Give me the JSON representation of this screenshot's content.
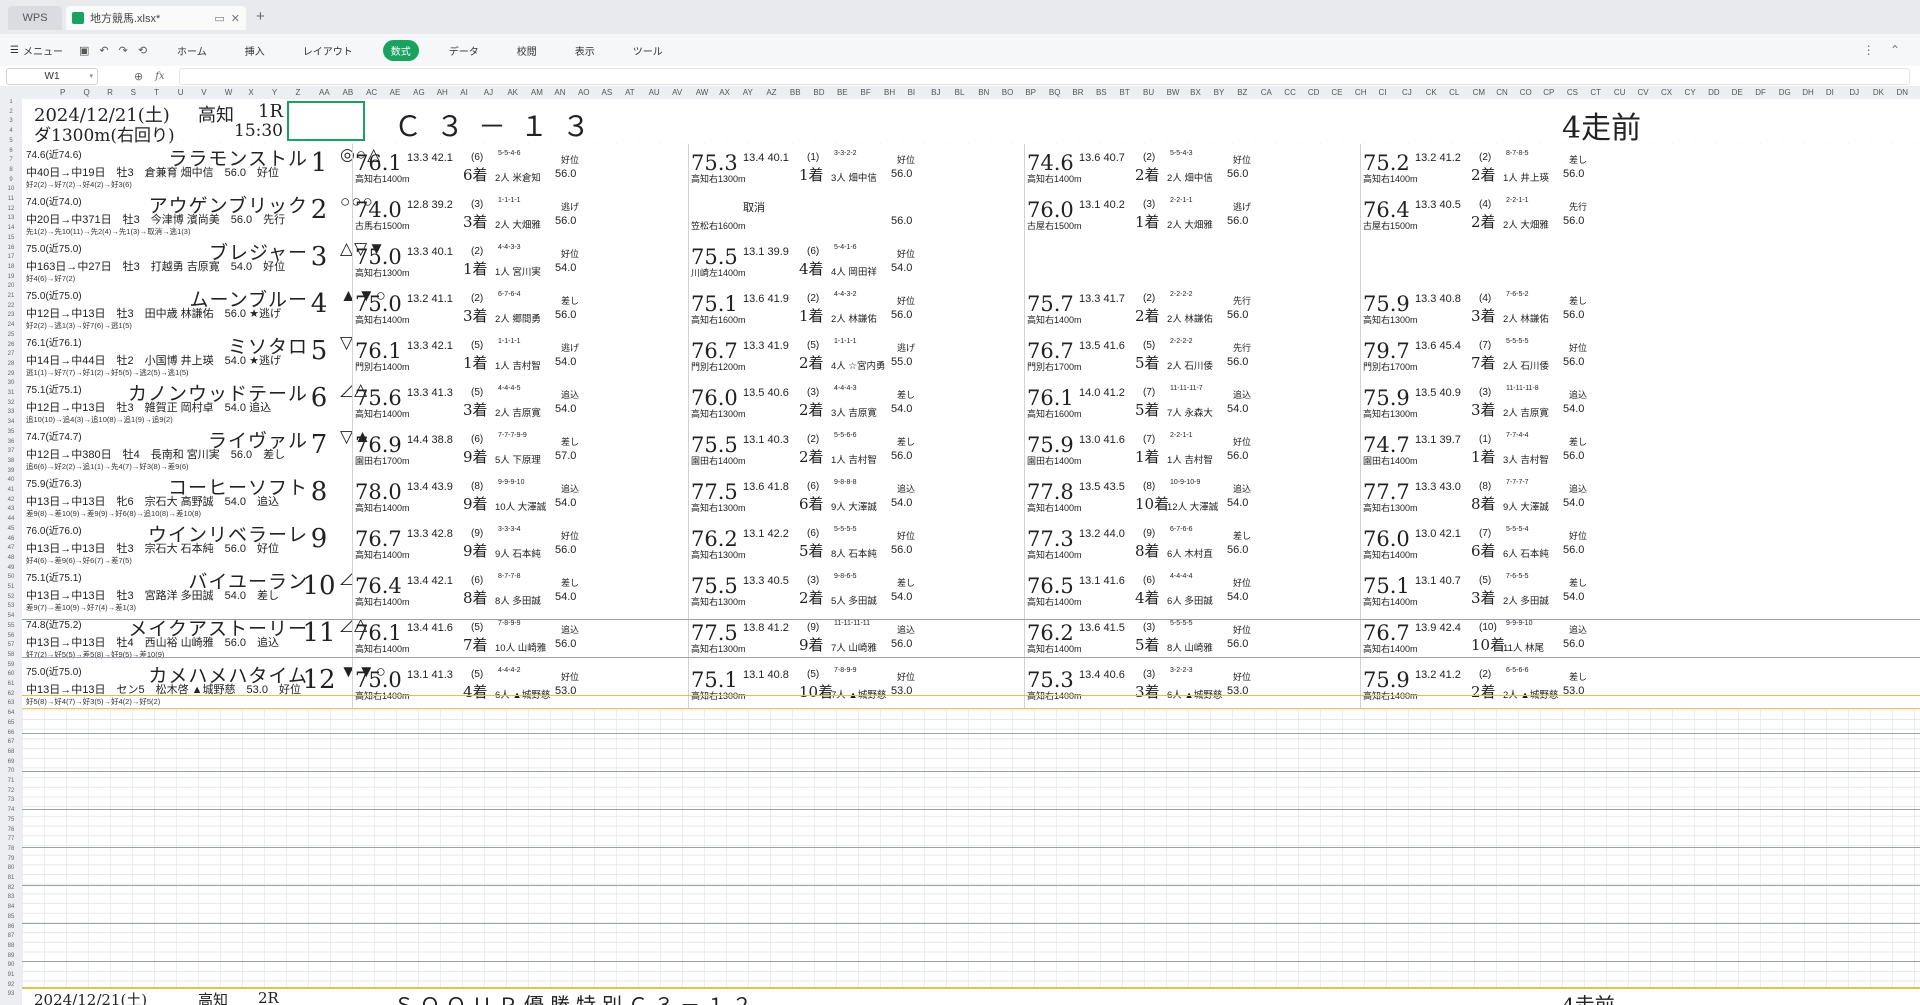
{
  "window": {
    "wps_tab": "WPS",
    "file_tab": "地方競馬.xlsx*"
  },
  "ribbon": {
    "menu": "メニュー",
    "tabs": [
      "ホーム",
      "挿入",
      "レイアウト",
      "数式",
      "データ",
      "校閲",
      "表示",
      "ツール"
    ],
    "active_tab": "数式"
  },
  "formula_bar": {
    "name_box": "W1",
    "fx": "fx"
  },
  "columns": [
    "P",
    "Q",
    "R",
    "S",
    "T",
    "U",
    "V",
    "W",
    "X",
    "Y",
    "Z",
    "AA",
    "AB",
    "AC",
    "AE",
    "AG",
    "AH",
    "AI",
    "AJ",
    "AK",
    "AM",
    "AN",
    "AO",
    "AS",
    "AT",
    "AU",
    "AV",
    "AW",
    "AX",
    "AY",
    "AZ",
    "BB",
    "BD",
    "BE",
    "BF",
    "BH",
    "BI",
    "BJ",
    "BL",
    "BN",
    "BO",
    "BP",
    "BQ",
    "BR",
    "BS",
    "BT",
    "BU",
    "BW",
    "BX",
    "BY",
    "BZ",
    "CA",
    "CC",
    "CD",
    "CE",
    "CH",
    "CI",
    "CJ",
    "CK",
    "CL",
    "CM",
    "CN",
    "CO",
    "CP",
    "CS",
    "CT",
    "CU",
    "CV",
    "CX",
    "CY",
    "DD",
    "DE",
    "DF",
    "DG",
    "DH",
    "DI",
    "DJ",
    "DK",
    "DN"
  ],
  "race": {
    "date": "2024/12/21(土)",
    "venue": "高知",
    "race_no": "1R",
    "course": "ダ1300m(右回り)",
    "time": "15:30",
    "class": "Ｃ３－１３",
    "prev_label": "4走前"
  },
  "horses": [
    {
      "no": "1",
      "name": "ララモンストル",
      "rating": "74.6(近74.6)",
      "info": "中40日→中19日　牡3　倉兼育 畑中信　56.0　好位",
      "passing": "好2(2)→好7(2)→好4(2)→好3(6)",
      "marks": "◎○△",
      "runs": [
        {
          "idx": "76.1",
          "f": "13.3 42.1",
          "pos": "(6)",
          "fin": "6着",
          "crs": "高知右1400m",
          "jk": "2人 米倉知",
          "kg": "56.0",
          "style": "好位",
          "pass": "5-5-4-6"
        },
        {
          "idx": "75.3",
          "f": "13.4 40.1",
          "pos": "(1)",
          "fin": "1着",
          "crs": "高知右1300m",
          "jk": "3人 畑中信",
          "kg": "56.0",
          "style": "好位",
          "pass": "3-3-2-2"
        },
        {
          "idx": "74.6",
          "f": "13.6 40.7",
          "pos": "(2)",
          "fin": "2着",
          "crs": "高知右1400m",
          "jk": "2人 畑中信",
          "kg": "56.0",
          "style": "好位",
          "pass": "5-5-4-3"
        },
        {
          "idx": "75.2",
          "f": "13.2 41.2",
          "pos": "(2)",
          "fin": "2着",
          "crs": "高知右1400m",
          "jk": "1人 井上瑛",
          "kg": "56.0",
          "style": "差し",
          "pass": "8-7-8-5"
        }
      ]
    },
    {
      "no": "2",
      "name": "アウゲンブリック",
      "rating": "74.0(近74.0)",
      "info": "中20日→中371日　牡3　今津博 濱尚美　56.0　先行",
      "passing": "先1(2)→先10(11)→先2(4)→先1(3)→取消→逃1(3)",
      "marks": "○○○",
      "runs": [
        {
          "idx": "74.0",
          "f": "12.8 39.2",
          "pos": "(3)",
          "fin": "3着",
          "crs": "古馬右1500m",
          "jk": "2人 大畑雅",
          "kg": "56.0",
          "style": "逃げ",
          "pass": "1-1-1-1"
        },
        {
          "idx": "",
          "f": "取消",
          "pos": "",
          "fin": "",
          "crs": "笠松右1600m",
          "jk": "",
          "kg": "56.0",
          "style": "",
          "pass": ""
        },
        {
          "idx": "76.0",
          "f": "13.1 40.2",
          "pos": "(3)",
          "fin": "1着",
          "crs": "古屋右1500m",
          "jk": "2人 大畑雅",
          "kg": "56.0",
          "style": "逃げ",
          "pass": "2-2-1-1"
        },
        {
          "idx": "76.4",
          "f": "13.3 40.5",
          "pos": "(4)",
          "fin": "2着",
          "crs": "古屋右1500m",
          "jk": "2人 大畑雅",
          "kg": "56.0",
          "style": "先行",
          "pass": "2-2-1-1"
        }
      ]
    },
    {
      "no": "3",
      "name": "ブレジャー",
      "rating": "75.0(近75.0)",
      "info": "中163日→中27日　牡3　打越勇 吉原寛　54.0　好位",
      "passing": "好4(6)→好7(2)",
      "marks": "△▽▼",
      "runs": [
        {
          "idx": "75.0",
          "f": "13.3 40.1",
          "pos": "(2)",
          "fin": "1着",
          "crs": "高知右1300m",
          "jk": "1人 宮川実",
          "kg": "54.0",
          "style": "好位",
          "pass": "4-4-3-3"
        },
        {
          "idx": "75.5",
          "f": "13.1 39.9",
          "pos": "(6)",
          "fin": "4着",
          "crs": "川崎左1400m",
          "jk": "4人 岡田祥",
          "kg": "54.0",
          "style": "好位",
          "pass": "5-4-1-6"
        },
        {
          "idx": "",
          "f": "",
          "pos": "",
          "fin": "",
          "crs": "",
          "jk": "",
          "kg": "",
          "style": "",
          "pass": ""
        },
        {
          "idx": "",
          "f": "",
          "pos": "",
          "fin": "",
          "crs": "",
          "jk": "",
          "kg": "",
          "style": "",
          "pass": ""
        }
      ]
    },
    {
      "no": "4",
      "name": "ムーンブルー",
      "rating": "75.0(近75.0)",
      "info": "中12日→中13日　牡3　田中歳 林謙佑　56.0 ★逃げ",
      "passing": "好2(2)→逃1(3)→好7(6)→逃1(5)",
      "marks": "▲▼○",
      "runs": [
        {
          "idx": "75.0",
          "f": "13.2 41.1",
          "pos": "(2)",
          "fin": "3着",
          "crs": "高知右1400m",
          "jk": "2人 郷間勇",
          "kg": "56.0",
          "style": "差し",
          "pass": "6-7-6-4"
        },
        {
          "idx": "75.1",
          "f": "13.6 41.9",
          "pos": "(2)",
          "fin": "1着",
          "crs": "高知右1600m",
          "jk": "2人 林謙佑",
          "kg": "56.0",
          "style": "好位",
          "pass": "4-4-3-2"
        },
        {
          "idx": "75.7",
          "f": "13.3 41.7",
          "pos": "(2)",
          "fin": "2着",
          "crs": "高知右1400m",
          "jk": "2人 林謙佑",
          "kg": "56.0",
          "style": "先行",
          "pass": "2-2-2-2"
        },
        {
          "idx": "75.9",
          "f": "13.3 40.8",
          "pos": "(4)",
          "fin": "3着",
          "crs": "高知右1300m",
          "jk": "2人 林謙佑",
          "kg": "56.0",
          "style": "差し",
          "pass": "7-6-5-2"
        }
      ]
    },
    {
      "no": "5",
      "name": "ミソタロ",
      "rating": "76.1(近76.1)",
      "info": "中14日→中44日　牡2　小国博 井上瑛　54.0 ★逃げ",
      "passing": "逃1(1)→好7(7)→好1(2)→好5(5)→逃2(5)→逃1(5)",
      "marks": "▽",
      "runs": [
        {
          "idx": "76.1",
          "f": "13.3 42.1",
          "pos": "(5)",
          "fin": "1着",
          "crs": "門別右1400m",
          "jk": "1人 吉村智",
          "kg": "54.0",
          "style": "逃げ",
          "pass": "1-1-1-1"
        },
        {
          "idx": "76.7",
          "f": "13.3 41.9",
          "pos": "(5)",
          "fin": "2着",
          "crs": "門別右1200m",
          "jk": "4人 ☆宮内勇",
          "kg": "55.0",
          "style": "逃げ",
          "pass": "1-1-1-1"
        },
        {
          "idx": "76.7",
          "f": "13.5 41.6",
          "pos": "(5)",
          "fin": "5着",
          "crs": "門別右1700m",
          "jk": "2人 石川倭",
          "kg": "56.0",
          "style": "先行",
          "pass": "2-2-2-2"
        },
        {
          "idx": "79.7",
          "f": "13.6 45.4",
          "pos": "(7)",
          "fin": "7着",
          "crs": "門別右1700m",
          "jk": "2人 石川倭",
          "kg": "56.0",
          "style": "好位",
          "pass": "5-5-5-5"
        }
      ]
    },
    {
      "no": "6",
      "name": "カノンウッドテール",
      "rating": "75.1(近75.1)",
      "info": "中12日→中13日　牡3　雑賀正 岡村卓　54.0 追込",
      "passing": "追10(10)→追4(3)→追10(8)→追1(9)→追9(2)",
      "marks": "◿△",
      "runs": [
        {
          "idx": "75.6",
          "f": "13.3 41.3",
          "pos": "(5)",
          "fin": "3着",
          "crs": "高知右1400m",
          "jk": "2人 吉原寛",
          "kg": "54.0",
          "style": "追込",
          "pass": "4-4-4-5"
        },
        {
          "idx": "76.0",
          "f": "13.5 40.6",
          "pos": "(3)",
          "fin": "2着",
          "crs": "高知右1300m",
          "jk": "3人 吉原寛",
          "kg": "54.0",
          "style": "差し",
          "pass": "4-4-4-3"
        },
        {
          "idx": "76.1",
          "f": "14.0 41.2",
          "pos": "(7)",
          "fin": "5着",
          "crs": "高知右1600m",
          "jk": "7人 永森大",
          "kg": "54.0",
          "style": "追込",
          "pass": "11-11-11-7"
        },
        {
          "idx": "75.9",
          "f": "13.5 40.9",
          "pos": "(3)",
          "fin": "3着",
          "crs": "高知右1300m",
          "jk": "2人 吉原寛",
          "kg": "54.0",
          "style": "追込",
          "pass": "11-11-11-8"
        }
      ]
    },
    {
      "no": "7",
      "name": "ライヴァル",
      "rating": "74.7(近74.7)",
      "info": "中12日→中380日　牡4　長南和 宮川実　56.0　差し",
      "passing": "追6(6)→好2(2)→追1(1)→先4(7)→好3(8)→差9(6)",
      "marks": "▽▲",
      "runs": [
        {
          "idx": "76.9",
          "f": "14.4 38.8",
          "pos": "(6)",
          "fin": "9着",
          "crs": "園田右1700m",
          "jk": "5人 下原理",
          "kg": "57.0",
          "style": "差し",
          "pass": "7-7-7-9-9"
        },
        {
          "idx": "75.5",
          "f": "13.1 40.3",
          "pos": "(2)",
          "fin": "2着",
          "crs": "園田右1400m",
          "jk": "1人 吉村智",
          "kg": "56.0",
          "style": "差し",
          "pass": "5-5-6-6"
        },
        {
          "idx": "75.9",
          "f": "13.0 41.6",
          "pos": "(7)",
          "fin": "1着",
          "crs": "園田右1400m",
          "jk": "1人 吉村智",
          "kg": "56.0",
          "style": "好位",
          "pass": "2-2-1-1"
        },
        {
          "idx": "74.7",
          "f": "13.1 39.7",
          "pos": "(1)",
          "fin": "1着",
          "crs": "園田右1400m",
          "jk": "3人 吉村智",
          "kg": "56.0",
          "style": "差し",
          "pass": "7-7-4-4"
        }
      ]
    },
    {
      "no": "8",
      "name": "コーヒーソフト",
      "rating": "75.9(近76.3)",
      "info": "中13日→中13日　牝6　宗石大 高野誠　54.0　追込",
      "passing": "差9(8)→差10(9)→差9(9)→好6(8)→追10(8)→差10(8)",
      "marks": "",
      "runs": [
        {
          "idx": "78.0",
          "f": "13.4 43.9",
          "pos": "(8)",
          "fin": "9着",
          "crs": "高知右1400m",
          "jk": "10人 大澤誠",
          "kg": "54.0",
          "style": "追込",
          "pass": "9-9-9-10"
        },
        {
          "idx": "77.5",
          "f": "13.6 41.8",
          "pos": "(6)",
          "fin": "6着",
          "crs": "高知右1300m",
          "jk": "9人 大澤誠",
          "kg": "54.0",
          "style": "追込",
          "pass": "9-8-8-8"
        },
        {
          "idx": "77.8",
          "f": "13.5 43.5",
          "pos": "(8)",
          "fin": "10着",
          "crs": "高知右1400m",
          "jk": "12人 大澤誠",
          "kg": "54.0",
          "style": "追込",
          "pass": "10-9-10-9"
        },
        {
          "idx": "77.7",
          "f": "13.3 43.0",
          "pos": "(8)",
          "fin": "8着",
          "crs": "高知右1300m",
          "jk": "9人 大澤誠",
          "kg": "54.0",
          "style": "追込",
          "pass": "7-7-7-7"
        }
      ]
    },
    {
      "no": "9",
      "name": "ウインリベラーレ",
      "rating": "76.0(近76.0)",
      "info": "中13日→中13日　牡3　宗石大 石本純　56.0　好位",
      "passing": "好4(6)→差9(6)→好6(7)→差7(5)",
      "marks": "",
      "runs": [
        {
          "idx": "76.7",
          "f": "13.3 42.8",
          "pos": "(9)",
          "fin": "9着",
          "crs": "高知右1400m",
          "jk": "9人 石本純",
          "kg": "56.0",
          "style": "好位",
          "pass": "3-3-3-4"
        },
        {
          "idx": "76.2",
          "f": "13.1 42.2",
          "pos": "(6)",
          "fin": "5着",
          "crs": "高知右1300m",
          "jk": "8人 石本純",
          "kg": "56.0",
          "style": "好位",
          "pass": "5-5-5-5"
        },
        {
          "idx": "77.3",
          "f": "13.2 44.0",
          "pos": "(9)",
          "fin": "8着",
          "crs": "高知右1400m",
          "jk": "6人 木村直",
          "kg": "56.0",
          "style": "差し",
          "pass": "6-7-6-6"
        },
        {
          "idx": "76.0",
          "f": "13.0 42.1",
          "pos": "(7)",
          "fin": "6着",
          "crs": "高知右1400m",
          "jk": "6人 石本純",
          "kg": "56.0",
          "style": "好位",
          "pass": "5-5-5-4"
        }
      ]
    },
    {
      "no": "10",
      "name": "バイユーラン",
      "rating": "75.1(近75.1)",
      "info": "中13日→中13日　牡3　宮路洋 多田誠　54.0　差し",
      "passing": "差9(7)→差10(9)→好7(4)→差1(3)",
      "marks": "◿",
      "runs": [
        {
          "idx": "76.4",
          "f": "13.4 42.1",
          "pos": "(6)",
          "fin": "8着",
          "crs": "高知右1400m",
          "jk": "8人 多田誠",
          "kg": "54.0",
          "style": "差し",
          "pass": "8-7-7-8"
        },
        {
          "idx": "75.5",
          "f": "13.3 40.5",
          "pos": "(3)",
          "fin": "2着",
          "crs": "高知右1300m",
          "jk": "5人 多田誠",
          "kg": "54.0",
          "style": "差し",
          "pass": "9-8-6-5"
        },
        {
          "idx": "76.5",
          "f": "13.1 41.6",
          "pos": "(6)",
          "fin": "4着",
          "crs": "高知右1400m",
          "jk": "6人 多田誠",
          "kg": "54.0",
          "style": "好位",
          "pass": "4-4-4-4"
        },
        {
          "idx": "75.1",
          "f": "13.1 40.7",
          "pos": "(5)",
          "fin": "3着",
          "crs": "高知右1400m",
          "jk": "2人 多田誠",
          "kg": "54.0",
          "style": "差し",
          "pass": "7-6-5-5"
        }
      ]
    },
    {
      "no": "11",
      "name": "メイクアストーリー",
      "rating": "74.8(近75.2)",
      "info": "中13日→中13日　牡4　西山裕 山崎雅　56.0　追込",
      "passing": "好7(2)→好5(5)→差5(8)→好9(5)→差10(9)",
      "marks": "◿△",
      "runs": [
        {
          "idx": "76.1",
          "f": "13.4 41.6",
          "pos": "(5)",
          "fin": "7着",
          "crs": "高知右1400m",
          "jk": "10人 山崎雅",
          "kg": "56.0",
          "style": "追込",
          "pass": "7-8-9-9"
        },
        {
          "idx": "77.5",
          "f": "13.8 41.2",
          "pos": "(9)",
          "fin": "9着",
          "crs": "高知右1300m",
          "jk": "7人 山崎雅",
          "kg": "56.0",
          "style": "追込",
          "pass": "11-11-11-11"
        },
        {
          "idx": "76.2",
          "f": "13.6 41.5",
          "pos": "(3)",
          "fin": "5着",
          "crs": "高知右1400m",
          "jk": "8人 山崎雅",
          "kg": "56.0",
          "style": "好位",
          "pass": "5-5-5-5"
        },
        {
          "idx": "76.7",
          "f": "13.9 42.4",
          "pos": "(10)",
          "fin": "10着",
          "crs": "高知右1400m",
          "jk": "11人 林尾",
          "kg": "56.0",
          "style": "追込",
          "pass": "9-9-9-10"
        }
      ]
    },
    {
      "no": "12",
      "name": "カメハメハタイム",
      "rating": "75.0(近75.0)",
      "info": "中13日→中13日　セン5　松木啓 ▲城野慈　53.0　好位",
      "passing": "好5(8)→好4(7)→好3(5)→好4(2)→好5(2)",
      "marks": "▼▼○",
      "runs": [
        {
          "idx": "75.0",
          "f": "13.1 41.3",
          "pos": "(5)",
          "fin": "4着",
          "crs": "高知右1400m",
          "jk": "6人 ▲城野慈",
          "kg": "53.0",
          "style": "好位",
          "pass": "4-4-4-2"
        },
        {
          "idx": "75.1",
          "f": "13.1 40.8",
          "pos": "(5)",
          "fin": "10着",
          "crs": "高知右1300m",
          "jk": "7人 ▲城野慈",
          "kg": "53.0",
          "style": "好位",
          "pass": "7-8-9-9"
        },
        {
          "idx": "75.3",
          "f": "13.4 40.6",
          "pos": "(3)",
          "fin": "3着",
          "crs": "高知右1400m",
          "jk": "6人 ▲城野慈",
          "kg": "53.0",
          "style": "好位",
          "pass": "3-2-2-3"
        },
        {
          "idx": "75.9",
          "f": "13.2 41.2",
          "pos": "(2)",
          "fin": "2着",
          "crs": "高知右1400m",
          "jk": "2人 ▲城野慈",
          "kg": "53.0",
          "style": "差し",
          "pass": "6-5-6-6"
        }
      ]
    }
  ],
  "next_race": {
    "date": "2024/12/21(土)",
    "venue": "高知",
    "race_no": "2R",
    "class": "ＳＯＯＵＰ優勝特別Ｃ３－１２",
    "prev_label": "4走前"
  }
}
